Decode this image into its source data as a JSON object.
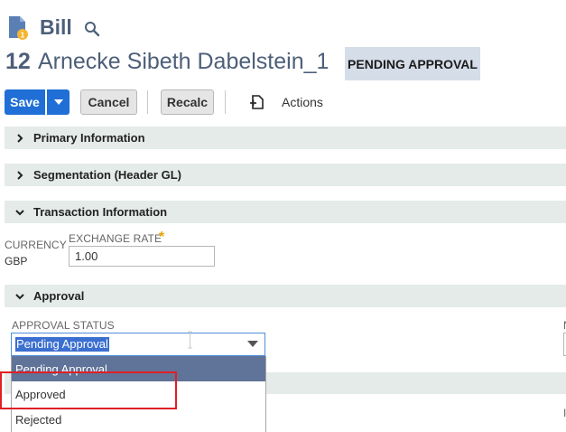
{
  "header": {
    "record_type": "Bill",
    "record_number": "12",
    "record_name": "Arnecke Sibeth Dabelstein_1",
    "status": "PENDING APPROVAL"
  },
  "toolbar": {
    "save_label": "Save",
    "cancel_label": "Cancel",
    "recalc_label": "Recalc",
    "actions_label": "Actions"
  },
  "sections": {
    "primary": "Primary Information",
    "segmentation": "Segmentation (Header GL)",
    "transaction": "Transaction Information",
    "approval": "Approval"
  },
  "fields": {
    "currency_label": "CURRENCY",
    "currency_value": "GBP",
    "exchange_rate_label": "EXCHANGE RATE",
    "exchange_rate_required": "*",
    "exchange_rate_value": "1.00",
    "approval_status_label": "APPROVAL STATUS",
    "approval_status_value": "Pending Approval",
    "right_label_partial": "N",
    "right_label_partial_2": "I"
  },
  "approval_options": [
    "Pending Approval",
    "Approved",
    "Rejected"
  ],
  "colors": {
    "brand_blue": "#1f6fd6",
    "section_bg": "#e4ebe9",
    "status_pill_bg": "#d5dde9",
    "highlight_red": "#e01f26",
    "dropdown_selected": "#607398"
  }
}
